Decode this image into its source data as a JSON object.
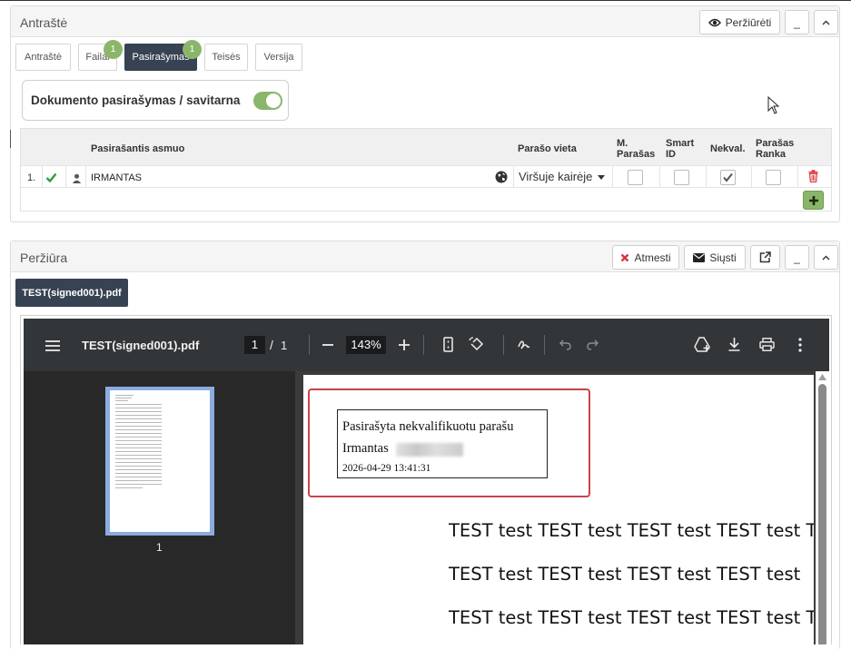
{
  "header_panel": {
    "title": "Antraštė",
    "preview_button": "Peržiūrėti",
    "minimize_label": "_",
    "collapse_label": "^"
  },
  "tabs": [
    {
      "label": "Antraštė"
    },
    {
      "label": "Failai",
      "badge": "1"
    },
    {
      "label": "Pasirašymas",
      "badge": "1"
    },
    {
      "label": "Teisės"
    },
    {
      "label": "Versija"
    }
  ],
  "toggle_label": "Dokumento pasirašymas / savitarna",
  "signers_table": {
    "headers": {
      "signer": "Pasirašantis asmuo",
      "place": "Parašo vieta",
      "m_sign": "M. Parašas",
      "smart_id": "Smart ID",
      "nekval": "Nekval.",
      "hand": "Parašas Ranka"
    },
    "rows": [
      {
        "index": "1.",
        "name": "IRMANTAS",
        "place": "Viršuje kairėje",
        "m_sign": false,
        "smart_id": false,
        "nekval": true,
        "hand": false
      }
    ]
  },
  "preview_panel": {
    "title": "Peržiūra",
    "reject_button": "Atmesti",
    "send_button": "Siųsti",
    "minimize_label": "_",
    "collapse_label": "^",
    "file_chip": "TEST(signed001).pdf"
  },
  "pdf_viewer": {
    "filename": "TEST(signed001).pdf",
    "current_page": "1",
    "page_separator": "/",
    "total_pages": "1",
    "zoom": "143%",
    "thumbnail_page_label": "1"
  },
  "pdf_page": {
    "stamp_title": "Pasirašyta nekvalifikuotu parašu",
    "stamp_name": "Irmantas",
    "stamp_date": "2026-04-29 13:41:31",
    "lines": [
      "TEST test TEST test TEST test TEST test TEST",
      "TEST test TEST test TEST test TEST test",
      "TEST test TEST test TEST test TEST test TEST"
    ]
  },
  "colors": {
    "primary_dark": "#374252",
    "badge_green": "#8bb66a",
    "check_green": "#2e9e3e",
    "reject_red": "#d9363e",
    "stamp_border_red": "#c9434a",
    "viewer_toolbar": "#323639",
    "viewer_bg": "#282828"
  }
}
